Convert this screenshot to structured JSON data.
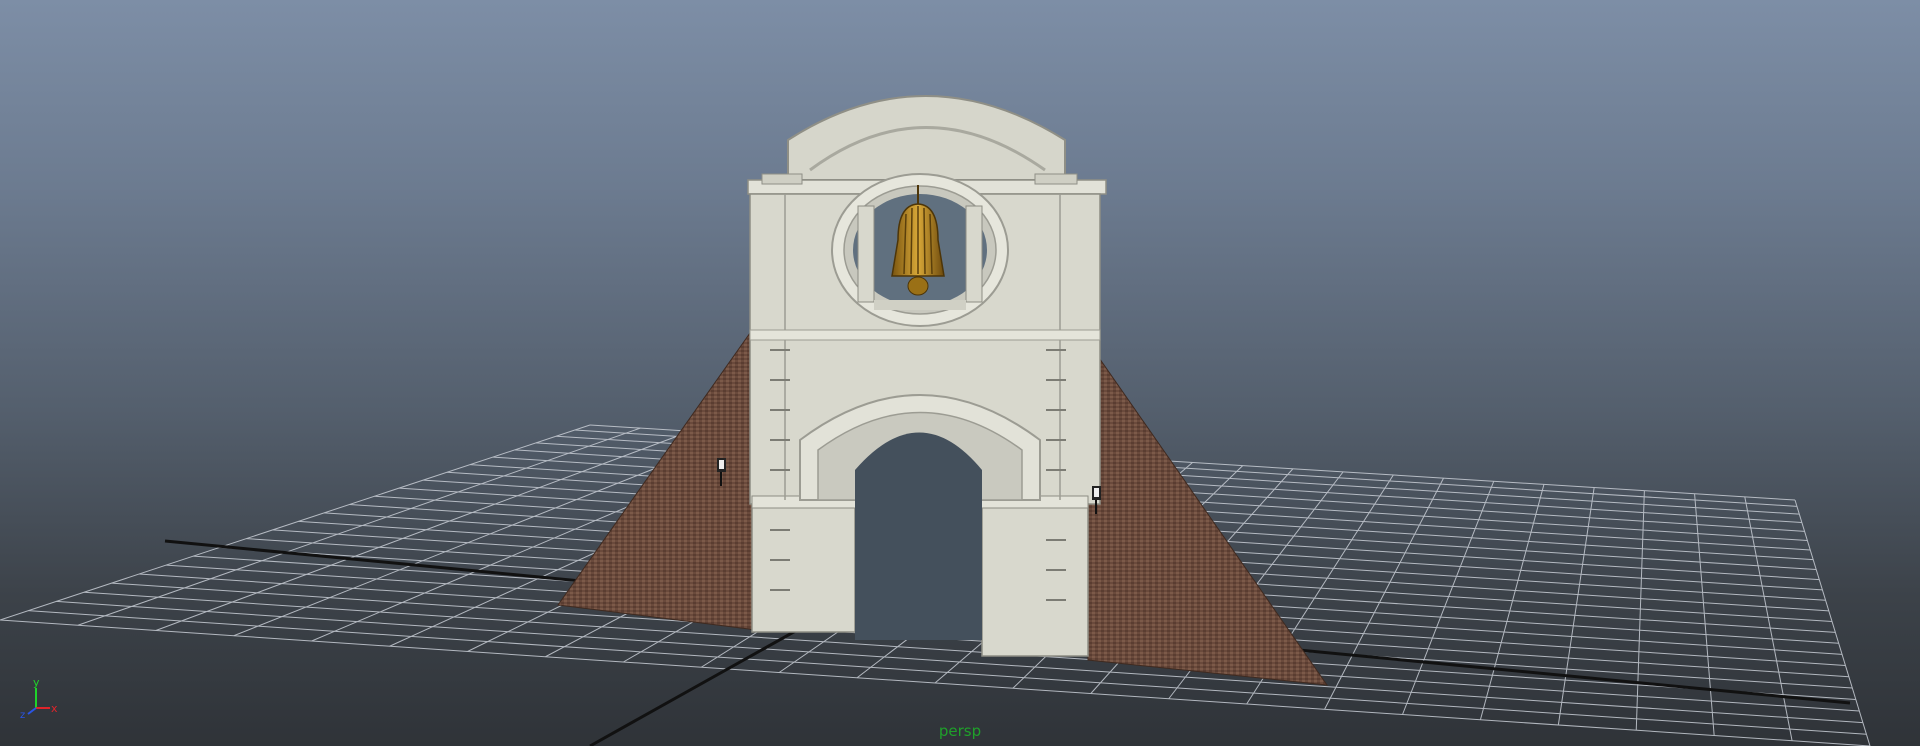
{
  "viewport": {
    "camera_label": "persp",
    "axis_labels": {
      "x": "x",
      "y": "y",
      "z": "z"
    },
    "colors": {
      "sky_top": "#7d8ea6",
      "sky_bottom": "#2f3338",
      "grid_line": "#c9ced6",
      "grid_axis": "#111111",
      "stone": "#d8d8cd",
      "brick": "#6a4a3c",
      "bell": "#b8881a",
      "camera_label": "#1fa02a"
    },
    "scene_objects": [
      "ground-grid",
      "gate-arch",
      "brick-ramp-left",
      "brick-ramp-right",
      "bell",
      "lantern-left",
      "lantern-right"
    ]
  }
}
